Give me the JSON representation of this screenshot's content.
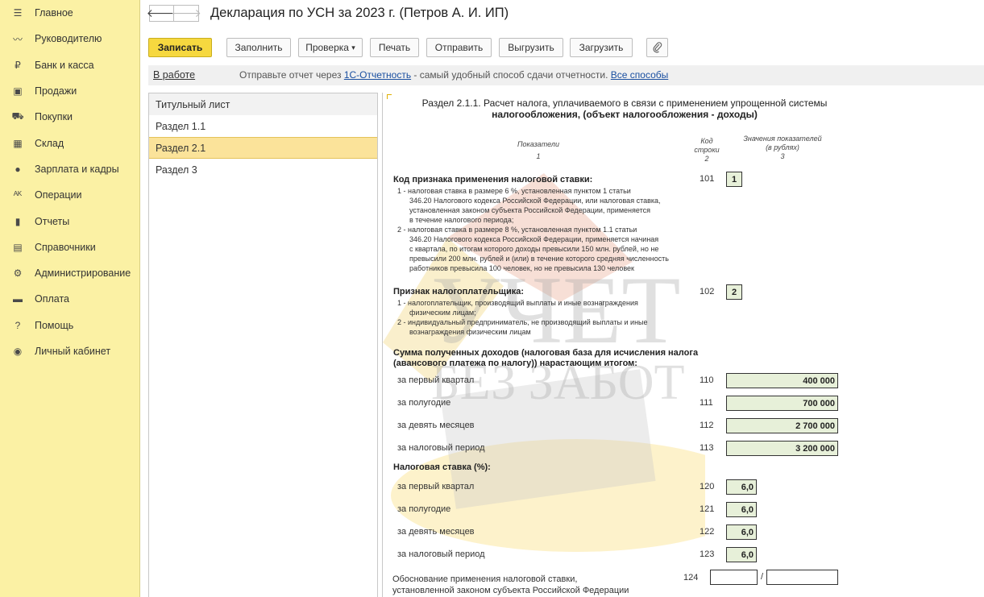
{
  "sidebar": {
    "items": [
      {
        "label": "Главное",
        "icon": "menu-icon"
      },
      {
        "label": "Руководителю",
        "icon": "trend-icon"
      },
      {
        "label": "Банк и касса",
        "icon": "ruble-coin-icon"
      },
      {
        "label": "Продажи",
        "icon": "bag-icon"
      },
      {
        "label": "Покупки",
        "icon": "cart-icon"
      },
      {
        "label": "Склад",
        "icon": "grid-icon"
      },
      {
        "label": "Зарплата и кадры",
        "icon": "person-icon"
      },
      {
        "label": "Операции",
        "icon": "dt-kt-icon"
      },
      {
        "label": "Отчеты",
        "icon": "bar-chart-icon"
      },
      {
        "label": "Справочники",
        "icon": "books-icon"
      },
      {
        "label": "Администрирование",
        "icon": "gear-icon"
      },
      {
        "label": "Оплата",
        "icon": "wallet-icon"
      },
      {
        "label": "Помощь",
        "icon": "question-icon"
      },
      {
        "label": "Личный кабинет",
        "icon": "account-icon"
      }
    ]
  },
  "header": {
    "back": "🡐",
    "forward": "🡒",
    "title": "Декларация по УСН за 2023 г. (Петров А. И. ИП)"
  },
  "toolbar": {
    "save": "Записать",
    "fill": "Заполнить",
    "check": "Проверка",
    "check_arrow": "▾",
    "print": "Печать",
    "send": "Отправить",
    "export": "Выгрузить",
    "import": "Загрузить"
  },
  "infobar": {
    "status": "В работе",
    "text_before": "Отправьте отчет через ",
    "link1": "1С-Отчетность",
    "text_middle": " - самый удобный способ сдачи отчетности. ",
    "link2": "Все способы"
  },
  "sections": [
    "Титульный лист",
    "Раздел 1.1",
    "Раздел 2.1",
    "Раздел 3"
  ],
  "report": {
    "title_line1": "Раздел 2.1.1. Расчет налога, уплачиваемого в связи с применением упрощенной системы",
    "title_line2": "налогообложения, (объект налогообложения - доходы)",
    "col1": "Показатели",
    "col1_num": "1",
    "col2_l1": "Код",
    "col2_l2": "строки",
    "col2_num": "2",
    "col3_l1": "Значения показателей",
    "col3_l2": "(в рублях)",
    "col3_num": "3",
    "r101_label": "Код признака применения налоговой ставки:",
    "r101_notes": [
      "1 - налоговая ставка в размере 6 %, установленная пунктом 1 статьи",
      "      346.20 Налогового кодекса Российской Федерации, или налоговая ставка,",
      "      установленная законом субъекта Российской Федерации, применяется",
      "      в течение налогового периода;",
      "2 - налоговая ставка в размере 8 %, установленная пунктом 1.1 статьи",
      "      346.20 Налогового кодекса Российской Федерации, применяется начиная",
      "      с квартала, по итогам которого доходы превысили 150 млн. рублей, но не",
      "      превысили 200 млн. рублей и (или) в течение которого средняя численность",
      "      работников превысила 100 человек, но не превысила 130 человек"
    ],
    "r101_code": "101",
    "r101_value": "1",
    "r102_label": "Признак налогоплательщика:",
    "r102_notes": [
      "1 - налогоплательщик, производящий выплаты и иные вознаграждения",
      "      физическим лицам;",
      "2 - индивидуальный предприниматель, не производящий выплаты и иные",
      "      вознаграждения физическим лицам"
    ],
    "r102_code": "102",
    "r102_value": "2",
    "income_label_l1": "Сумма полученных доходов (налоговая база для исчисления налога",
    "income_label_l2": "(авансового платежа по налогу)) нарастающим итогом:",
    "income_rows": [
      {
        "label": "за первый квартал",
        "code": "110",
        "value": "400 000"
      },
      {
        "label": "за полугодие",
        "code": "111",
        "value": "700 000"
      },
      {
        "label": "за девять месяцев",
        "code": "112",
        "value": "2 700 000"
      },
      {
        "label": "за налоговый период",
        "code": "113",
        "value": "3 200 000"
      }
    ],
    "rate_label": "Налоговая ставка (%):",
    "rate_rows": [
      {
        "label": "за первый квартал",
        "code": "120",
        "value": "6,0"
      },
      {
        "label": "за полугодие",
        "code": "121",
        "value": "6,0"
      },
      {
        "label": "за девять месяцев",
        "code": "122",
        "value": "6,0"
      },
      {
        "label": "за налоговый период",
        "code": "123",
        "value": "6,0"
      }
    ],
    "r124_label_l1": "Обоснование применения налоговой ставки,",
    "r124_label_l2": "установленной законом субъекта Российской Федерации",
    "r124_code": "124",
    "r124_sep": "/",
    "r124_value1": "",
    "r124_value2": ""
  },
  "watermark": {
    "line1": "УЧЕТ",
    "line2": "БЕЗ ЗАБОТ"
  }
}
